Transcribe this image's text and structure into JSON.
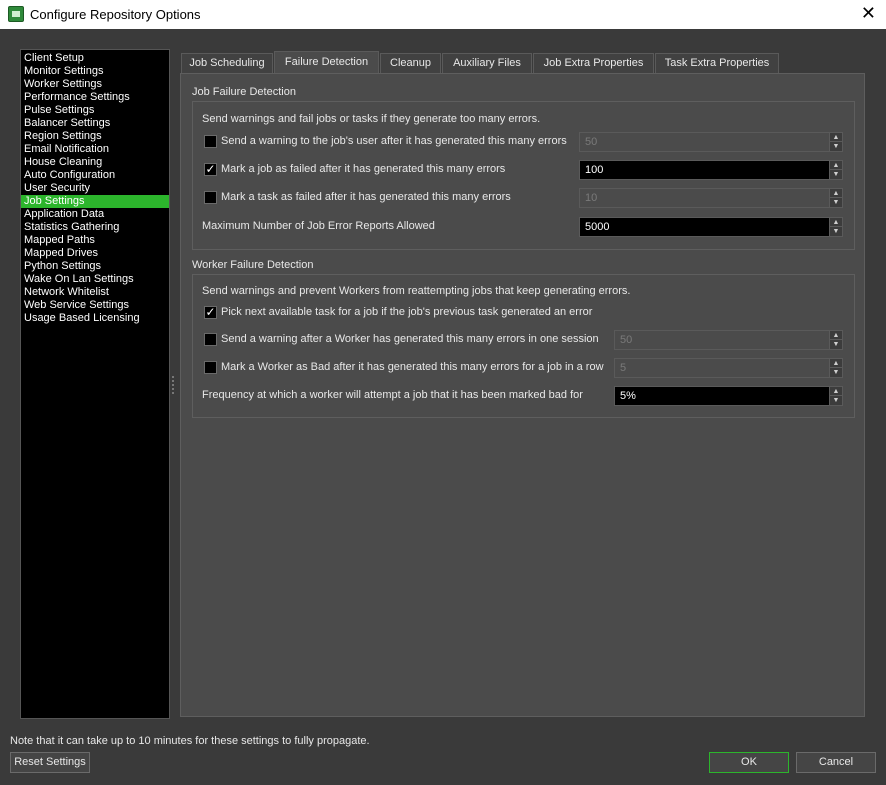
{
  "window": {
    "title": "Configure Repository Options",
    "close_glyph": "✕"
  },
  "sidebar": {
    "items": [
      "Client Setup",
      "Monitor Settings",
      "Worker Settings",
      "Performance Settings",
      "Pulse Settings",
      "Balancer Settings",
      "Region Settings",
      "Email Notification",
      "House Cleaning",
      "Auto Configuration",
      "User Security",
      "Job Settings",
      "Application Data",
      "Statistics Gathering",
      "Mapped Paths",
      "Mapped Drives",
      "Python Settings",
      "Wake On Lan Settings",
      "Network Whitelist",
      "Web Service Settings",
      "Usage Based Licensing"
    ],
    "active_index": 11,
    "active_color": "#2cb52c"
  },
  "tabs": [
    "Job Scheduling",
    "Failure Detection",
    "Cleanup",
    "Auxiliary Files",
    "Job Extra Properties",
    "Task Extra Properties"
  ],
  "active_tab": 1,
  "job_failure": {
    "title": "Job Failure Detection",
    "description": "Send warnings and fail jobs or tasks if they generate too many errors.",
    "warn_user": {
      "label": "Send a warning to the job's user after it has generated this many errors",
      "checked": false,
      "value": "50"
    },
    "fail_job": {
      "label": "Mark a job as failed after it has generated this many errors",
      "checked": true,
      "value": "100"
    },
    "fail_task": {
      "label": "Mark a task as failed after it has generated this many errors",
      "checked": false,
      "value": "10"
    },
    "max_reports": {
      "label": "Maximum Number of Job Error Reports Allowed",
      "value": "5000"
    }
  },
  "worker_failure": {
    "title": "Worker Failure Detection",
    "description": "Send warnings and prevent Workers from reattempting jobs that keep generating errors.",
    "pick_next": {
      "label": "Pick next available task for a job if the job's previous task generated an error",
      "checked": true
    },
    "warn_session": {
      "label": "Send a warning after a Worker has generated this many errors in one session",
      "checked": false,
      "value": "50"
    },
    "mark_bad": {
      "label": "Mark a Worker as Bad after it has generated this many errors for a job in a row",
      "checked": false,
      "value": "5"
    },
    "frequency": {
      "label": "Frequency at which a worker will attempt a job that it has been marked bad for",
      "value": "5%"
    }
  },
  "footer": {
    "note": "Note that it can take up to 10 minutes for these settings to fully propagate.",
    "reset_label": "Reset Settings",
    "ok_label": "OK",
    "cancel_label": "Cancel"
  },
  "icons": {
    "check_glyph": "✓",
    "spin_up": "▲",
    "spin_down": "▼"
  }
}
